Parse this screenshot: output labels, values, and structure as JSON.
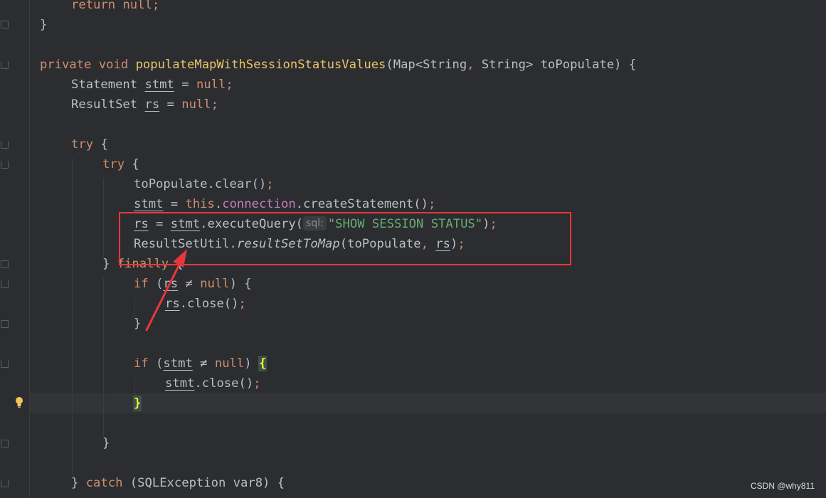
{
  "editor": {
    "lines": [
      {
        "tokens": [
          {
            "t": "return",
            "c": "kw"
          },
          {
            "t": " "
          },
          {
            "t": "null",
            "c": "kw"
          },
          {
            "t": ";",
            "c": "kw"
          }
        ]
      },
      {
        "tokens": [
          {
            "t": "}"
          }
        ]
      },
      {
        "tokens": []
      },
      {
        "tokens": [
          {
            "t": "private",
            "c": "kw"
          },
          {
            "t": " "
          },
          {
            "t": "void",
            "c": "kw"
          },
          {
            "t": " "
          },
          {
            "t": "populateMapWithSessionStatusValues",
            "c": "fndecl"
          },
          {
            "t": "(Map<String"
          },
          {
            "t": ",",
            "c": "kw"
          },
          {
            "t": " String> toPopulate) {"
          }
        ]
      },
      {
        "tokens": [
          {
            "t": "Statement "
          },
          {
            "t": "stmt",
            "c": "local"
          },
          {
            "t": " = "
          },
          {
            "t": "null",
            "c": "kw"
          },
          {
            "t": ";",
            "c": "kw"
          }
        ]
      },
      {
        "tokens": [
          {
            "t": "ResultSet "
          },
          {
            "t": "rs",
            "c": "local"
          },
          {
            "t": " = "
          },
          {
            "t": "null",
            "c": "kw"
          },
          {
            "t": ";",
            "c": "kw"
          }
        ]
      },
      {
        "tokens": []
      },
      {
        "tokens": [
          {
            "t": "try",
            "c": "kw"
          },
          {
            "t": " {"
          }
        ]
      },
      {
        "tokens": [
          {
            "t": "try",
            "c": "kw"
          },
          {
            "t": " {"
          }
        ]
      },
      {
        "tokens": [
          {
            "t": "toPopulate.clear()"
          },
          {
            "t": ";",
            "c": "kw"
          }
        ]
      },
      {
        "tokens": [
          {
            "t": "stmt",
            "c": "local"
          },
          {
            "t": " = "
          },
          {
            "t": "this",
            "c": "kw"
          },
          {
            "t": "."
          },
          {
            "t": "connection",
            "c": "field"
          },
          {
            "t": ".createStatement()"
          },
          {
            "t": ";",
            "c": "kw"
          }
        ]
      },
      {
        "tokens": [
          {
            "t": "rs",
            "c": "local"
          },
          {
            "t": " = "
          },
          {
            "t": "stmt",
            "c": "local"
          },
          {
            "t": ".executeQuery("
          },
          {
            "t": "sql:",
            "c": "hint"
          },
          {
            "t": "\"SHOW SESSION STATUS\"",
            "c": "str"
          },
          {
            "t": ")"
          },
          {
            "t": ";",
            "c": "kw"
          }
        ]
      },
      {
        "tokens": [
          {
            "t": "ResultSetUtil."
          },
          {
            "t": "resultSetToMap",
            "c": "ital"
          },
          {
            "t": "(toPopulate"
          },
          {
            "t": ",",
            "c": "kw"
          },
          {
            "t": " "
          },
          {
            "t": "rs",
            "c": "local"
          },
          {
            "t": ")"
          },
          {
            "t": ";",
            "c": "kw"
          }
        ]
      },
      {
        "tokens": [
          {
            "t": "} "
          },
          {
            "t": "finally",
            "c": "kw"
          },
          {
            "t": " {"
          }
        ]
      },
      {
        "tokens": [
          {
            "t": "if",
            "c": "kw"
          },
          {
            "t": " ("
          },
          {
            "t": "rs",
            "c": "local"
          },
          {
            "t": " ≠ "
          },
          {
            "t": "null",
            "c": "kw"
          },
          {
            "t": ") {"
          }
        ]
      },
      {
        "tokens": [
          {
            "t": "rs",
            "c": "local"
          },
          {
            "t": ".close()"
          },
          {
            "t": ";",
            "c": "kw"
          }
        ]
      },
      {
        "tokens": [
          {
            "t": "}"
          }
        ]
      },
      {
        "tokens": []
      },
      {
        "tokens": [
          {
            "t": "if",
            "c": "kw"
          },
          {
            "t": " ("
          },
          {
            "t": "stmt",
            "c": "local"
          },
          {
            "t": " ≠ "
          },
          {
            "t": "null",
            "c": "kw"
          },
          {
            "t": ") "
          },
          {
            "t": "{",
            "c": "brace-match"
          }
        ]
      },
      {
        "tokens": [
          {
            "t": "stmt",
            "c": "local"
          },
          {
            "t": ".close()"
          },
          {
            "t": ";",
            "c": "kw"
          }
        ]
      },
      {
        "tokens": [
          {
            "t": "}",
            "c": "brace-match"
          }
        ]
      },
      {
        "tokens": []
      },
      {
        "tokens": [
          {
            "t": "}"
          }
        ]
      },
      {
        "tokens": []
      },
      {
        "tokens": [
          {
            "t": "} "
          },
          {
            "t": "catch",
            "c": "kw"
          },
          {
            "t": " (SQLException var8) {"
          }
        ]
      }
    ]
  },
  "watermark": "CSDN @why811",
  "colors": {
    "background": "#2b2d30",
    "keyword": "#cf8e6d",
    "method_declaration": "#e8c46a",
    "field": "#c77dbb",
    "string": "#6aab73",
    "annotation_box": "#e8373b"
  },
  "icons": {
    "gutter": [
      "fold-icon",
      "bulb-icon"
    ],
    "annotation": [
      "arrow-icon"
    ]
  }
}
